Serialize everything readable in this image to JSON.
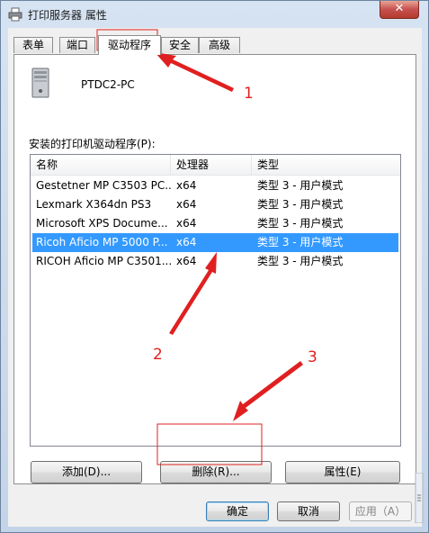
{
  "window": {
    "title": "打印服务器 属性",
    "close_label": "✕"
  },
  "tabs": [
    "表单",
    "端口",
    "驱动程序",
    "安全",
    "高级"
  ],
  "server_name": "PTDC2-PC",
  "drivers_label": "安装的打印机驱动程序(P):",
  "columns": [
    "名称",
    "处理器",
    "类型"
  ],
  "drivers": [
    {
      "name": "Gestetner MP C3503 PC...",
      "processor": "x64",
      "type": "类型 3 - 用户模式"
    },
    {
      "name": "Lexmark X364dn PS3",
      "processor": "x64",
      "type": "类型 3 - 用户模式"
    },
    {
      "name": "Microsoft XPS Docume...",
      "processor": "x64",
      "type": "类型 3 - 用户模式"
    },
    {
      "name": "Ricoh Aficio MP 5000 P...",
      "processor": "x64",
      "type": "类型 3 - 用户模式"
    },
    {
      "name": "RICOH Aficio MP C3501...",
      "processor": "x64",
      "type": "类型 3 - 用户模式"
    }
  ],
  "selected_index": 3,
  "buttons": {
    "add": "添加(D)...",
    "remove": "删除(R)...",
    "properties": "属性(E)",
    "ok": "确定",
    "cancel": "取消",
    "apply": "应用（A）"
  },
  "annotations": [
    "1",
    "2",
    "3"
  ],
  "colors": {
    "selection": "#3399ff",
    "annotation": "#e02020"
  }
}
